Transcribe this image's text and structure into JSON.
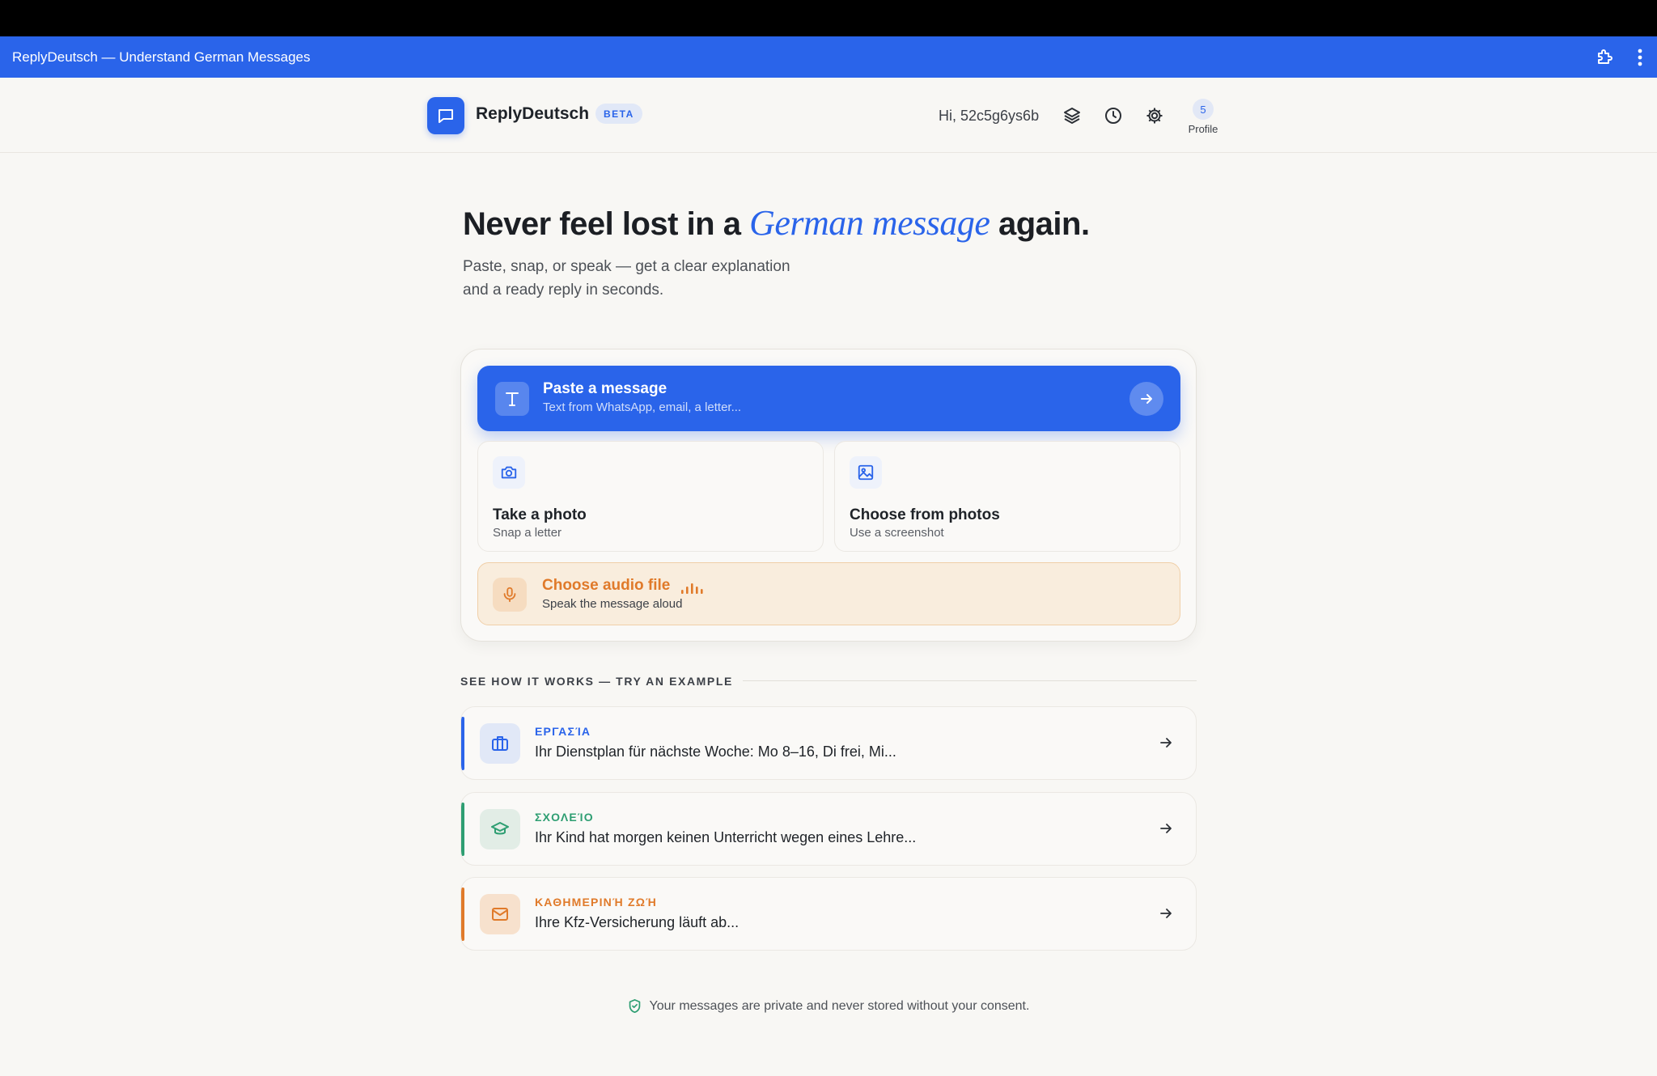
{
  "window": {
    "title": "ReplyDeutsch — Understand German Messages",
    "icons": [
      "extension-icon",
      "more-vertical-icon"
    ]
  },
  "header": {
    "brand": "ReplyDeutsch",
    "badge": "BETA",
    "greeting": "Hi, 52c5g6ys6b",
    "icons": [
      "layers-icon",
      "history-icon",
      "gear-icon"
    ],
    "profile_count": "5",
    "profile_label": "Profile"
  },
  "hero": {
    "title_before": "Never feel lost in a ",
    "title_accent": "German message",
    "title_after": " again.",
    "subtitle": "Paste, snap, or speak — get a clear explanation and a ready reply in seconds."
  },
  "input_card": {
    "paste": {
      "title": "Paste a message",
      "subtitle": "Text from WhatsApp, email, a letter..."
    },
    "photo": {
      "title": "Take a photo",
      "subtitle": "Snap a letter"
    },
    "gallery": {
      "title": "Choose from photos",
      "subtitle": "Use a screenshot"
    },
    "audio": {
      "title": "Choose audio file",
      "subtitle": "Speak the message aloud"
    }
  },
  "examples": {
    "label": "SEE HOW IT WORKS — TRY AN EXAMPLE",
    "items": [
      {
        "category": "ΕΡΓΑΣΊΑ",
        "text": "Ihr Dienstplan für nächste Woche: Mo 8–16, Di frei, Mi...",
        "icon": "briefcase-icon",
        "color": "#2a64ea"
      },
      {
        "category": "ΣΧΟΛΕΊΟ",
        "text": "Ihr Kind hat morgen keinen Unterricht wegen eines Lehre...",
        "icon": "graduation-cap-icon",
        "color": "#2e9e72"
      },
      {
        "category": "ΚΑΘΗΜΕΡΙΝΉ ΖΩΉ",
        "text": "Ihre Kfz-Versicherung läuft ab...",
        "icon": "mail-icon",
        "color": "#e07a2a"
      }
    ]
  },
  "footer": {
    "privacy": "Your messages are private and never stored without your consent."
  },
  "colors": {
    "primary": "#2a64ea",
    "background": "#f8f7f4",
    "audio_accent": "#e07a2a",
    "school_accent": "#2e9e72"
  }
}
